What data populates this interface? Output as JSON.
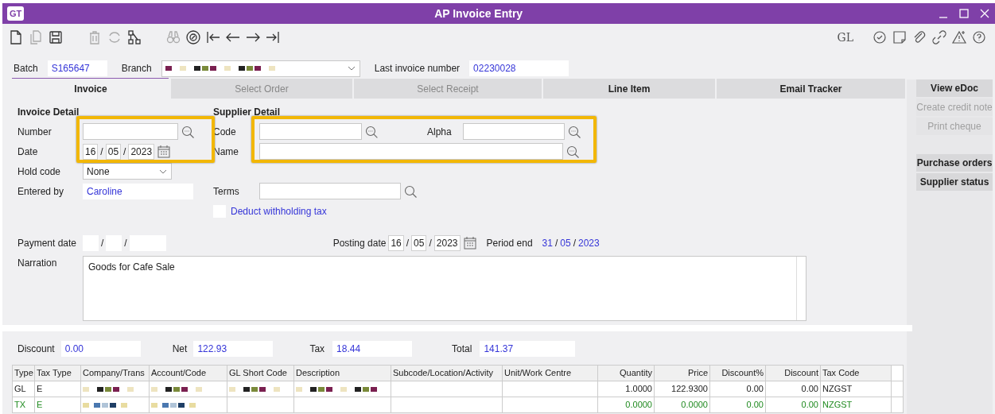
{
  "window": {
    "logo": "GT",
    "title": "AP Invoice Entry"
  },
  "toolbar": {
    "left_icons": [
      {
        "disabled": false
      },
      {
        "disabled": true
      },
      {
        "disabled": false
      },
      {
        "disabled": true
      },
      {
        "disabled": true
      },
      {
        "disabled": false
      },
      {
        "disabled": true
      },
      {
        "disabled": false
      },
      {
        "disabled": false
      },
      {
        "disabled": false
      },
      {
        "disabled": false
      },
      {
        "disabled": false
      }
    ],
    "right_label": "GL"
  },
  "header": {
    "batch_label": "Batch",
    "batch": "S165647",
    "branch_label": "Branch",
    "last_invoice_label": "Last invoice number",
    "last_invoice": "02230028"
  },
  "tabs": [
    {
      "label": "Invoice",
      "selected": true,
      "disabled": false
    },
    {
      "label": "Select Order",
      "selected": false,
      "disabled": true
    },
    {
      "label": "Select Receipt",
      "selected": false,
      "disabled": true
    },
    {
      "label": "Line Item",
      "selected": false,
      "disabled": false
    },
    {
      "label": "Email Tracker",
      "selected": false,
      "disabled": false
    }
  ],
  "side_button_groups": [
    [
      {
        "label": "View eDoc",
        "disabled": false
      },
      {
        "label": "Create credit note",
        "disabled": true
      },
      {
        "label": "Print cheque",
        "disabled": true
      }
    ],
    [
      {
        "label": "Purchase orders",
        "disabled": false
      },
      {
        "label": "Supplier status",
        "disabled": false
      }
    ]
  ],
  "invoice_detail": {
    "heading": "Invoice Detail",
    "number_label": "Number",
    "date_label": "Date",
    "date": [
      "16",
      "05",
      "2023"
    ],
    "hold_label": "Hold code",
    "hold": "None",
    "entered_label": "Entered by",
    "entered": "Caroline"
  },
  "supplier_detail": {
    "heading": "Supplier Detail",
    "code_label": "Code",
    "alpha_label": "Alpha",
    "name_label": "Name",
    "terms_label": "Terms",
    "withholding": {
      "label": "Deduct withholding tax",
      "checked": false
    }
  },
  "dates": {
    "payment_label": "Payment date",
    "separator": "/",
    "posting_label": "Posting date",
    "posting": [
      "16",
      "05",
      "2023"
    ],
    "period_label": "Period end",
    "period": [
      "31",
      "05",
      "2023"
    ]
  },
  "narration": {
    "label": "Narration",
    "value": "Goods for Cafe Sale"
  },
  "totals": [
    {
      "label": "Discount",
      "value": "0.00"
    },
    {
      "label": "Net",
      "value": "122.93"
    },
    {
      "label": "Tax",
      "value": "18.44"
    },
    {
      "label": "Total",
      "value": "141.37"
    }
  ],
  "table": {
    "columns": [
      {
        "label": "Type",
        "kind": "text"
      },
      {
        "label": "Tax Type",
        "kind": "text"
      },
      {
        "label": "Company/Trans",
        "kind": "text"
      },
      {
        "label": "Account/Code",
        "kind": "text"
      },
      {
        "label": "GL Short Code",
        "kind": "text"
      },
      {
        "label": "Description",
        "kind": "text"
      },
      {
        "label": "Subcode/Location/Activity",
        "kind": "text"
      },
      {
        "label": "Unit/Work Centre",
        "kind": "text"
      },
      {
        "label": "Quantity",
        "kind": "number"
      },
      {
        "label": "Price",
        "kind": "number"
      },
      {
        "label": "Discount%",
        "kind": "number"
      },
      {
        "label": "Discount",
        "kind": "number"
      },
      {
        "label": "Tax Code",
        "kind": "text"
      }
    ],
    "rows": [
      {
        "kind": "line",
        "cells": [
          {
            "text": "GL"
          },
          {
            "text": "E"
          },
          {
            "kind": "blurred"
          },
          {
            "kind": "blurred"
          },
          {
            "kind": "blurred"
          },
          {
            "kind": "blurred"
          },
          {},
          {},
          {
            "text": "1.0000"
          },
          {
            "text": "122.9300"
          },
          {
            "text": "0.00"
          },
          {
            "text": "0.00"
          },
          {
            "text": "NZGST"
          }
        ]
      },
      {
        "kind": "tax",
        "cells": [
          {
            "text": "TX"
          },
          {
            "text": "E"
          },
          {
            "kind": "blurred"
          },
          {
            "kind": "blurred"
          },
          {},
          {},
          {},
          {},
          {
            "text": "0.0000"
          },
          {
            "text": "0.0000"
          },
          {
            "text": "0.00"
          },
          {
            "text": "0.00"
          },
          {
            "text": "NZGST"
          }
        ]
      }
    ]
  }
}
